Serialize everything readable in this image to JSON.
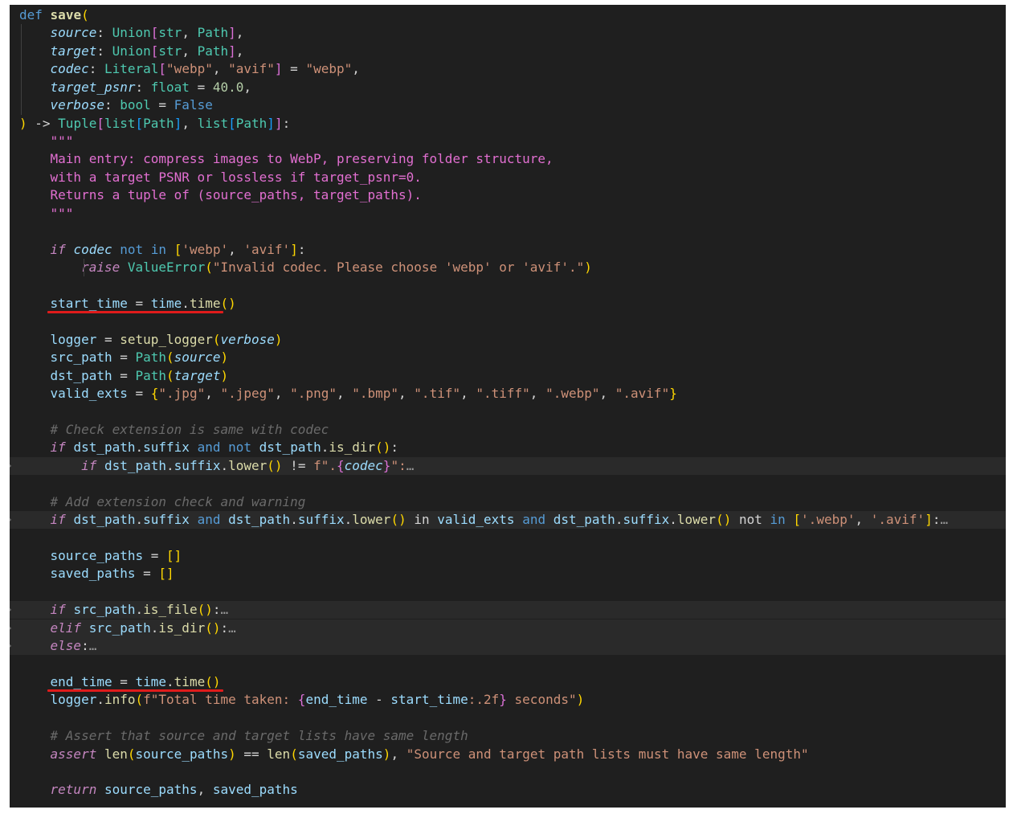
{
  "annotation_color": "#e01b1b",
  "code_lines": [
    "def save(",
    "    source: Union[str, Path],",
    "    target: Union[str, Path],",
    "    codec: Literal[\"webp\", \"avif\"] = \"webp\",",
    "    target_psnr: float = 40.0,",
    "    verbose: bool = False",
    ") -> Tuple[list[Path], list[Path]]:",
    "    \"\"\"",
    "    Main entry: compress images to WebP, preserving folder structure,",
    "    with a target PSNR or lossless if target_psnr=0.",
    "    Returns a tuple of (source_paths, target_paths).",
    "    \"\"\"",
    "",
    "    if codec not in ['webp', 'avif']:",
    "        raise ValueError(\"Invalid codec. Please choose 'webp' or 'avif'.\")",
    "",
    "    start_time = time.time()",
    "",
    "    logger = setup_logger(verbose)",
    "    src_path = Path(source)",
    "    dst_path = Path(target)",
    "    valid_exts = {\".jpg\", \".jpeg\", \".png\", \".bmp\", \".tif\", \".tiff\", \".webp\", \".avif\"}",
    "",
    "    # Check extension is same with codec",
    "    if dst_path.suffix and not dst_path.is_dir():",
    "        if dst_path.suffix.lower() != f\".{codec}\":…",
    "",
    "    # Add extension check and warning",
    "    if dst_path.suffix and dst_path.suffix.lower() in valid_exts and dst_path.suffix.lower() not in ['.webp', '.avif']:…",
    "",
    "    source_paths = []",
    "    saved_paths = []",
    "",
    "    if src_path.is_file():…",
    "    elif src_path.is_dir():…",
    "    else:…",
    "",
    "    end_time = time.time()",
    "    logger.info(f\"Total time taken: {end_time - start_time:.2f} seconds\")",
    "",
    "    # Assert that source and target lists have same length",
    "    assert len(source_paths) == len(saved_paths), \"Source and target path lists must have same length\"",
    "",
    "    return source_paths, saved_paths"
  ]
}
